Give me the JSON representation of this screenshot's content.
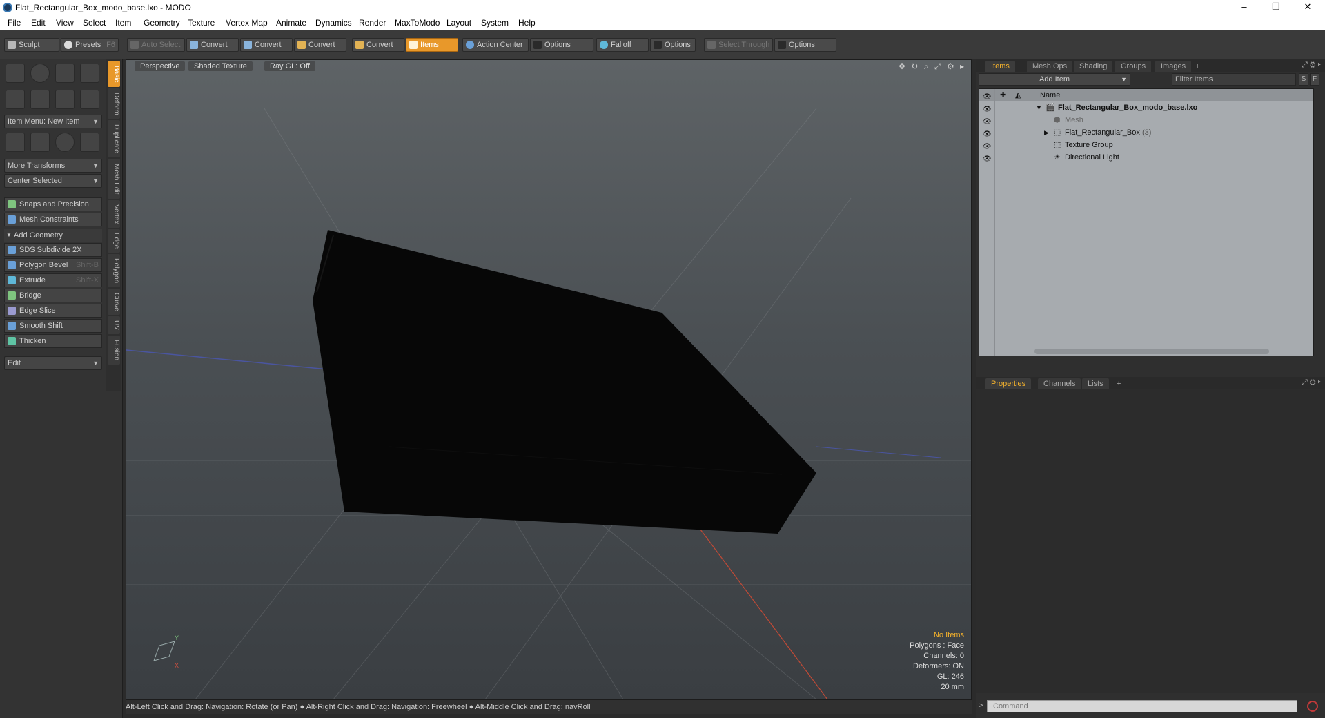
{
  "window": {
    "title": "Flat_Rectangular_Box_modo_base.lxo - MODO",
    "min": "–",
    "max": "❐",
    "close": "✕"
  },
  "menu": [
    "File",
    "Edit",
    "View",
    "Select",
    "Item",
    "Geometry",
    "Texture",
    "Vertex Map",
    "Animate",
    "Dynamics",
    "Render",
    "MaxToModo",
    "Layout",
    "System",
    "Help"
  ],
  "toolbar": {
    "sculpt": "Sculpt",
    "presets": "Presets",
    "presets_key": "F6",
    "auto_select": "Auto Select",
    "convert1": "Convert",
    "convert2": "Convert",
    "convert3": "Convert",
    "convert4": "Convert",
    "items": "Items",
    "action_center": "Action Center",
    "options1": "Options",
    "falloff": "Falloff",
    "options2": "Options",
    "select_through": "Select Through",
    "options3": "Options"
  },
  "left": {
    "item_menu": "Item Menu: New Item",
    "more_transforms": "More Transforms",
    "center_selected": "Center Selected",
    "snaps": "Snaps and Precision",
    "mesh_constraints": "Mesh Constraints",
    "add_geometry": "Add Geometry",
    "sds": "SDS Subdivide 2X",
    "polygon_bevel": "Polygon Bevel",
    "polygon_bevel_key": "Shift-B",
    "extrude": "Extrude",
    "extrude_key": "Shift-X",
    "bridge": "Bridge",
    "edge_slice": "Edge Slice",
    "smooth_shift": "Smooth Shift",
    "thicken": "Thicken",
    "edit": "Edit",
    "vtabs": [
      "Basic",
      "Deform",
      "Duplicate",
      "Mesh Edit",
      "Vertex",
      "Edge",
      "Polygon",
      "Curve",
      "UV",
      "Fusion"
    ]
  },
  "viewport": {
    "perspective": "Perspective",
    "shaded": "Shaded Texture",
    "raygl": "Ray GL: Off",
    "info": {
      "no_items": "No Items",
      "polygons": "Polygons : Face",
      "channels": "Channels: 0",
      "deformers": "Deformers: ON",
      "gl": "GL: 246",
      "scale": "20 mm"
    }
  },
  "status": "Alt-Left Click and Drag: Navigation: Rotate (or Pan) ● Alt-Right Click and Drag: Navigation: Freewheel ● Alt-Middle Click and Drag: navRoll",
  "right": {
    "tabs": [
      "Items",
      "Mesh Ops",
      "Shading",
      "Groups",
      "Images",
      "+"
    ],
    "add_item": "Add Item",
    "filter": "Filter Items",
    "s": "S",
    "f": "F",
    "col_name": "Name",
    "tree": [
      {
        "label": "Flat_Rectangular_Box_modo_base.lxo"
      },
      {
        "label": "Mesh"
      },
      {
        "label": "Flat_Rectangular_Box",
        "count": "(3)"
      },
      {
        "label": "Texture Group"
      },
      {
        "label": "Directional Light"
      }
    ],
    "prop_tabs": [
      "Properties",
      "Channels",
      "Lists",
      "+"
    ],
    "command": "Command"
  }
}
